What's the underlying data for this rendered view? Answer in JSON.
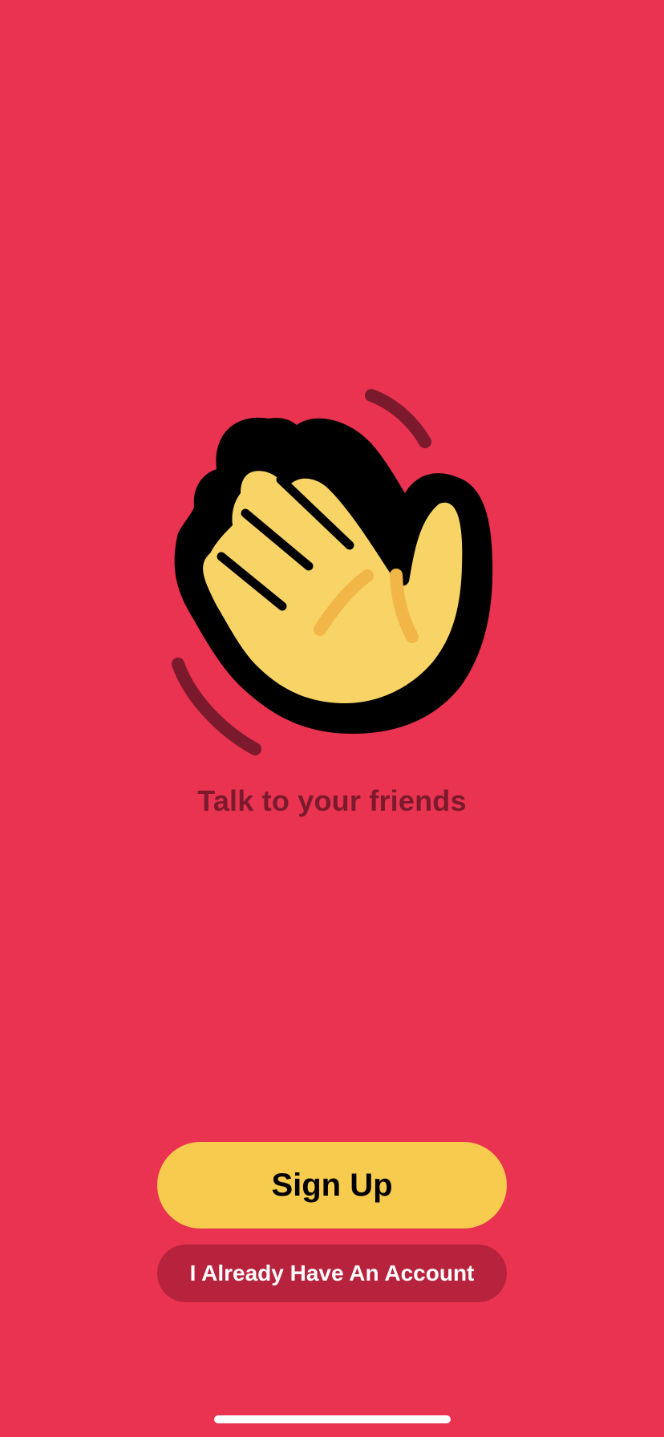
{
  "welcome": {
    "tagline": "Talk to your friends",
    "logo_icon": "waving-hand-icon"
  },
  "actions": {
    "signup_label": "Sign Up",
    "existing_account_label": "I Already Have An Account"
  },
  "colors": {
    "background": "#E93350",
    "signup_button": "#F7CC4E",
    "existing_account_button": "#B7223D",
    "tagline": "#7A1A2C",
    "hand_fill": "#F8D466",
    "motion_lines": "#7A1A2C"
  }
}
